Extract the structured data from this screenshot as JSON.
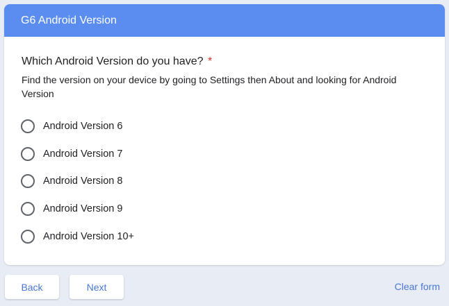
{
  "form": {
    "section_title": "G6 Android Version",
    "question": "Which Android Version do you have?",
    "required_mark": "*",
    "help_text": "Find the version on your device by going to Settings then About and looking for Android Version",
    "options": [
      {
        "label": "Android Version 6",
        "selected": false
      },
      {
        "label": "Android Version 7",
        "selected": false
      },
      {
        "label": "Android Version 8",
        "selected": false
      },
      {
        "label": "Android Version 9",
        "selected": false
      },
      {
        "label": "Android Version 10+",
        "selected": false
      }
    ]
  },
  "navigation": {
    "back_label": "Back",
    "next_label": "Next",
    "clear_label": "Clear form"
  },
  "colors": {
    "header_bg": "#5b8df0",
    "page_bg": "#e8edf5",
    "accent": "#4a77d6",
    "required": "#d93025"
  }
}
